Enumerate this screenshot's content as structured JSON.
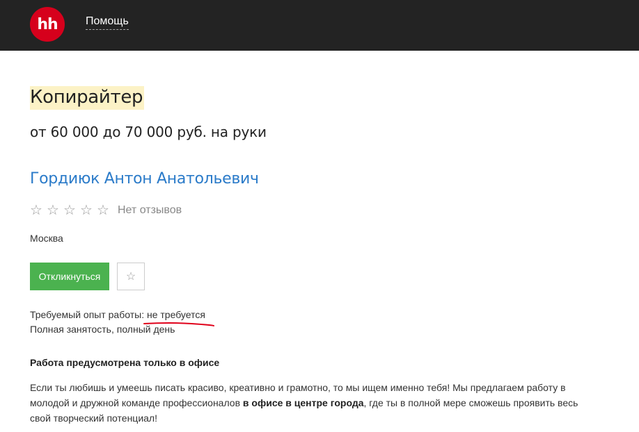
{
  "header": {
    "logo_text": "hh",
    "help_link": "Помощь"
  },
  "vacancy": {
    "title": "Копирайтер",
    "salary": "от 60 000 до 70 000 руб. на руки",
    "company": "Гордиюк Антон Анатольевич",
    "rating": {
      "stars_filled": 0,
      "stars_total": 5,
      "reviews_text": "Нет отзывов"
    },
    "city": "Москва",
    "respond_button": "Откликнуться",
    "experience_label": "Требуемый опыт работы:",
    "experience_value": "не требуется",
    "employment": "Полная занятость, полный день",
    "office_note": "Работа предусмотрена только в офисе",
    "description": {
      "part1": "Если ты любишь и умеешь писать красиво, креативно и грамотно, то мы ищем именно тебя! Мы предлагаем работу в молодой и дружной команде профессионалов ",
      "bold": "в офисе в центре города",
      "part2": ", где ты в полной мере сможешь проявить весь свой творческий потенциал!"
    }
  },
  "colors": {
    "header_bg": "#232323",
    "logo_red": "#d6001c",
    "link_blue": "#2b7bc9",
    "button_green": "#4bb24f",
    "title_highlight": "#fcf2c6",
    "annotation_red": "#e0001a"
  },
  "icons": {
    "star": "star-outline-icon",
    "favorite": "star-outline-icon"
  }
}
